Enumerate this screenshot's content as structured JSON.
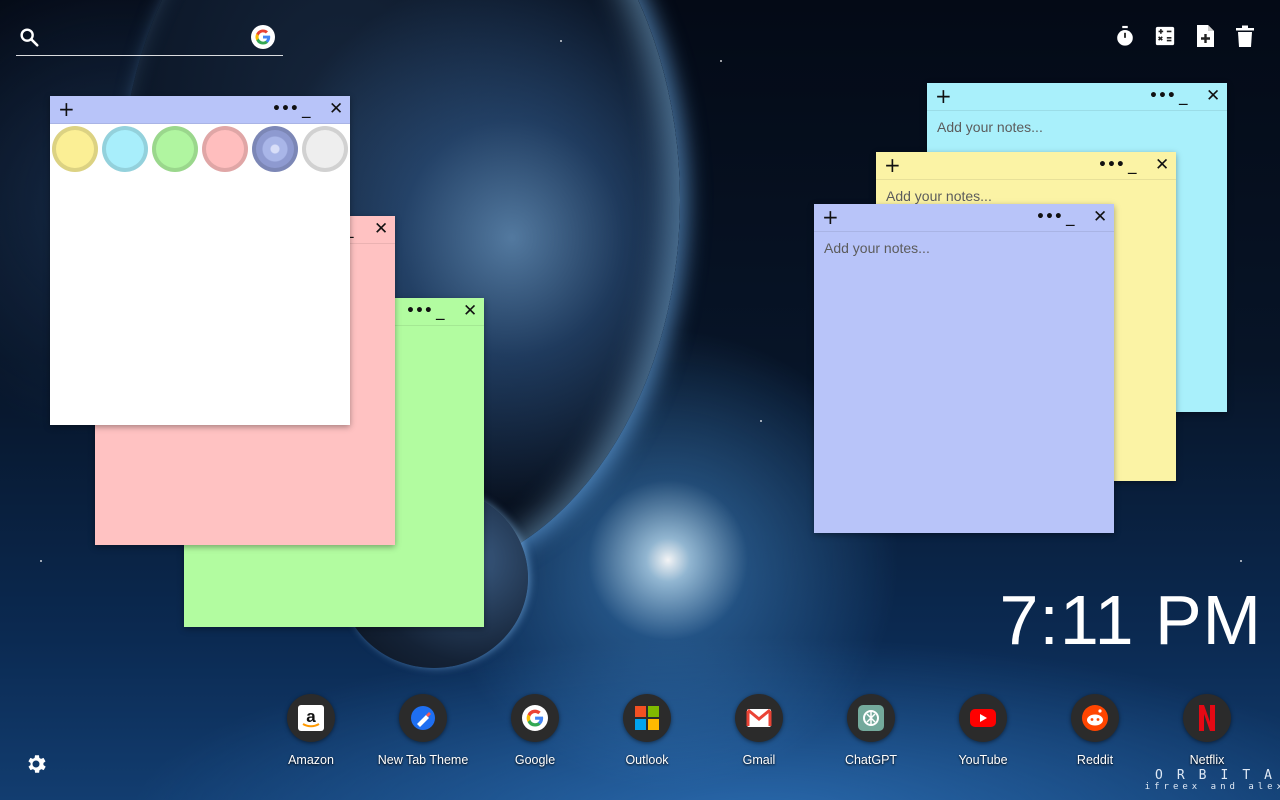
{
  "search": {
    "placeholder": ""
  },
  "toolbar": {
    "items": [
      {
        "icon": "timer-icon"
      },
      {
        "icon": "calculator-icon"
      },
      {
        "icon": "new-note-icon"
      },
      {
        "icon": "trash-icon"
      }
    ]
  },
  "notes": {
    "white": {
      "color": "#ffffff",
      "swatches": [
        "#fbef95",
        "#a8eefb",
        "#b0f5a0",
        "#ffbebe",
        "#a9b6e8",
        "#eeeeee"
      ]
    },
    "pink": {
      "color": "#ffc2c2"
    },
    "green": {
      "color": "#b2fca0"
    },
    "cyan": {
      "color": "#a9f0fb",
      "placeholder": "Add your notes..."
    },
    "yellow": {
      "color": "#fbf3a5",
      "placeholder": "Add your notes..."
    },
    "periwinkle": {
      "color": "#b8c4f9",
      "placeholder": "Add your notes..."
    }
  },
  "controls": {
    "add": "+",
    "more": "•••",
    "minimize": "_",
    "close": "✕"
  },
  "clock": {
    "time": "7:11 PM"
  },
  "dock": {
    "apps": [
      {
        "label": "Amazon",
        "icon": "amazon-icon"
      },
      {
        "label": "New Tab Theme",
        "icon": "new-tab-theme-icon"
      },
      {
        "label": "Google",
        "icon": "google-icon"
      },
      {
        "label": "Outlook",
        "icon": "outlook-icon"
      },
      {
        "label": "Gmail",
        "icon": "gmail-icon"
      },
      {
        "label": "ChatGPT",
        "icon": "chatgpt-icon"
      },
      {
        "label": "YouTube",
        "icon": "youtube-icon"
      },
      {
        "label": "Reddit",
        "icon": "reddit-icon"
      },
      {
        "label": "Netflix",
        "icon": "netflix-icon"
      }
    ]
  },
  "brand": {
    "name": "ORBITA",
    "credit": "ifreex and alex"
  }
}
